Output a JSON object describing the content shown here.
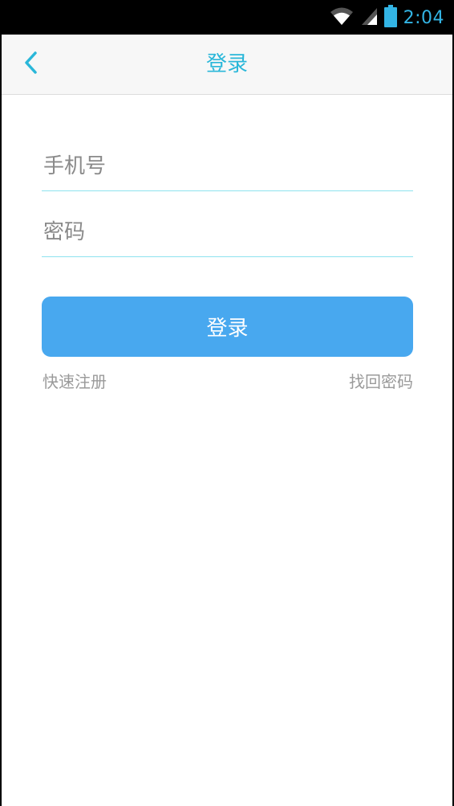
{
  "status_bar": {
    "time": "2:04",
    "icons": [
      "wifi-icon",
      "signal-icon",
      "battery-icon"
    ],
    "accent_color": "#33b5e5"
  },
  "nav": {
    "title": "登录",
    "back_icon": "chevron-left-icon",
    "title_color": "#2ab7d9"
  },
  "form": {
    "phone_placeholder": "手机号",
    "password_placeholder": "密码",
    "login_label": "登录",
    "button_color": "#48a8ef"
  },
  "links": {
    "register": "快速注册",
    "forgot_password": "找回密码"
  }
}
